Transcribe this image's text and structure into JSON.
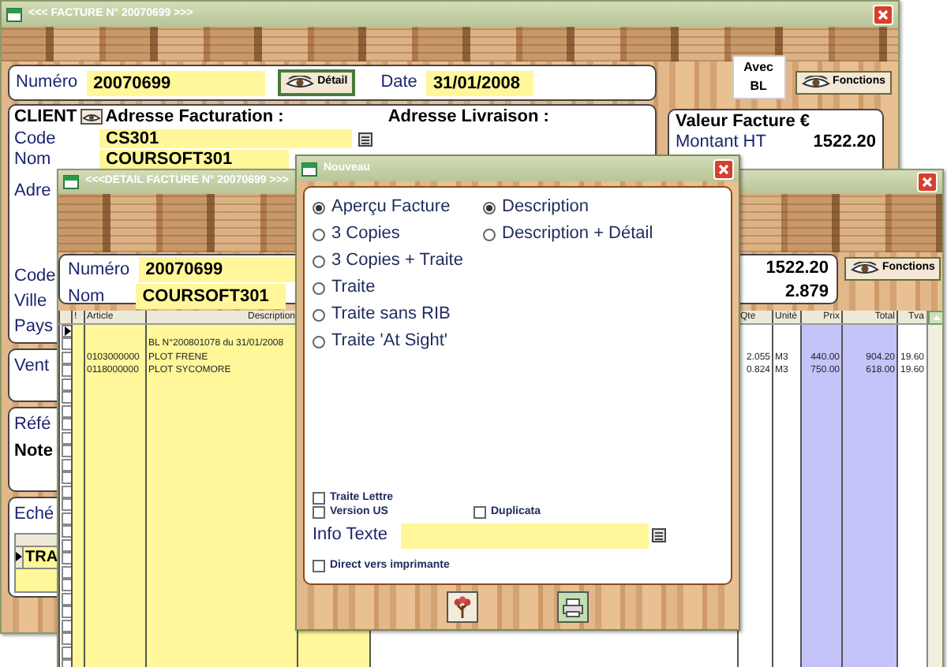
{
  "invoice_window": {
    "title": "<<< FACTURE N° 20070699 >>>",
    "header": {
      "numero_label": "Numéro",
      "numero": "20070699",
      "detail_button": "Détail",
      "date_label": "Date",
      "date": "31/01/2008"
    },
    "avec_bl_button": [
      "Avec",
      "BL"
    ],
    "functions_button": "Fonctions",
    "client": {
      "title": "CLIENT",
      "billing_title": "Adresse Facturation :",
      "delivery_title": "Adresse Livraison :",
      "fields": [
        {
          "label": "Code",
          "value": "CS301",
          "kind": "lookup"
        },
        {
          "label": "Nom",
          "value": "COURSOFT301",
          "kind": "field"
        },
        {
          "label": "Adre",
          "kind": "area"
        },
        {
          "label": "Code",
          "kind": "line"
        },
        {
          "label": "Ville",
          "kind": "line"
        },
        {
          "label": "Pays",
          "kind": "line"
        }
      ]
    },
    "total_panel": {
      "title": "Valeur Facture €",
      "rows": [
        {
          "label": "Montant HT",
          "value": "1522.20"
        }
      ]
    },
    "side_panels": [
      {
        "lines": [
          {
            "text": "Vent",
            "kind": "label"
          }
        ]
      },
      {
        "lines": [
          {
            "text": "Réfé",
            "kind": "label"
          },
          {
            "text": "Note",
            "kind": "heading"
          }
        ]
      },
      {
        "lines": [
          {
            "text": "Eché",
            "kind": "label"
          }
        ],
        "table_rows": [
          {
            "cell": "TRA",
            "current": true
          }
        ]
      }
    ]
  },
  "detail_window": {
    "title": "<<<DETAIL FACTURE N° 20070699 >>>",
    "numero_label": "Numéro",
    "numero": "20070699",
    "nom_label": "Nom",
    "nom": "COURSOFT301",
    "amounts": [
      "1522.20",
      "2.879"
    ],
    "functions_button": "Fonctions",
    "grid": {
      "columns": [
        "!",
        "Article",
        "Description",
        "Qte",
        "Unité",
        "Prix",
        "Total",
        "Tva"
      ],
      "rows": [
        {
          "current": true
        },
        {
          "current": false,
          "description": "BL N°200801078  du 31/01/2008"
        },
        {
          "current": false,
          "article": "0103000000",
          "description": "PLOT FRENE",
          "qte": "2.055",
          "unit": "M3",
          "prix": "440.00",
          "total": "904.20",
          "tva": "19.60"
        },
        {
          "current": false,
          "article": "0118000000",
          "description": "PLOT SYCOMORE",
          "qte": "0.824",
          "unit": "M3",
          "prix": "750.00",
          "total": "618.00",
          "tva": "19.60"
        }
      ]
    }
  },
  "dialog": {
    "title": "Nouveau",
    "print_options": [
      {
        "label": "Aperçu Facture",
        "selected": true
      },
      {
        "label": "3 Copies",
        "selected": false
      },
      {
        "label": "3 Copies + Traite",
        "selected": false
      },
      {
        "label": "Traite",
        "selected": false
      },
      {
        "label": "Traite sans RIB",
        "selected": false
      },
      {
        "label": "Traite 'At Sight'",
        "selected": false
      }
    ],
    "description_options": [
      {
        "label": "Description",
        "selected": true
      },
      {
        "label": "Description + Détail",
        "selected": false
      }
    ],
    "option_rows": [
      [
        {
          "label": "Traite Lettre",
          "checked": false
        }
      ],
      [
        {
          "label": "Version US",
          "checked": false
        },
        {
          "label": "Duplicata",
          "checked": false
        }
      ]
    ],
    "info_label": "Info Texte",
    "direct_print": {
      "label": "Direct vers imprimante",
      "checked": false
    }
  }
}
